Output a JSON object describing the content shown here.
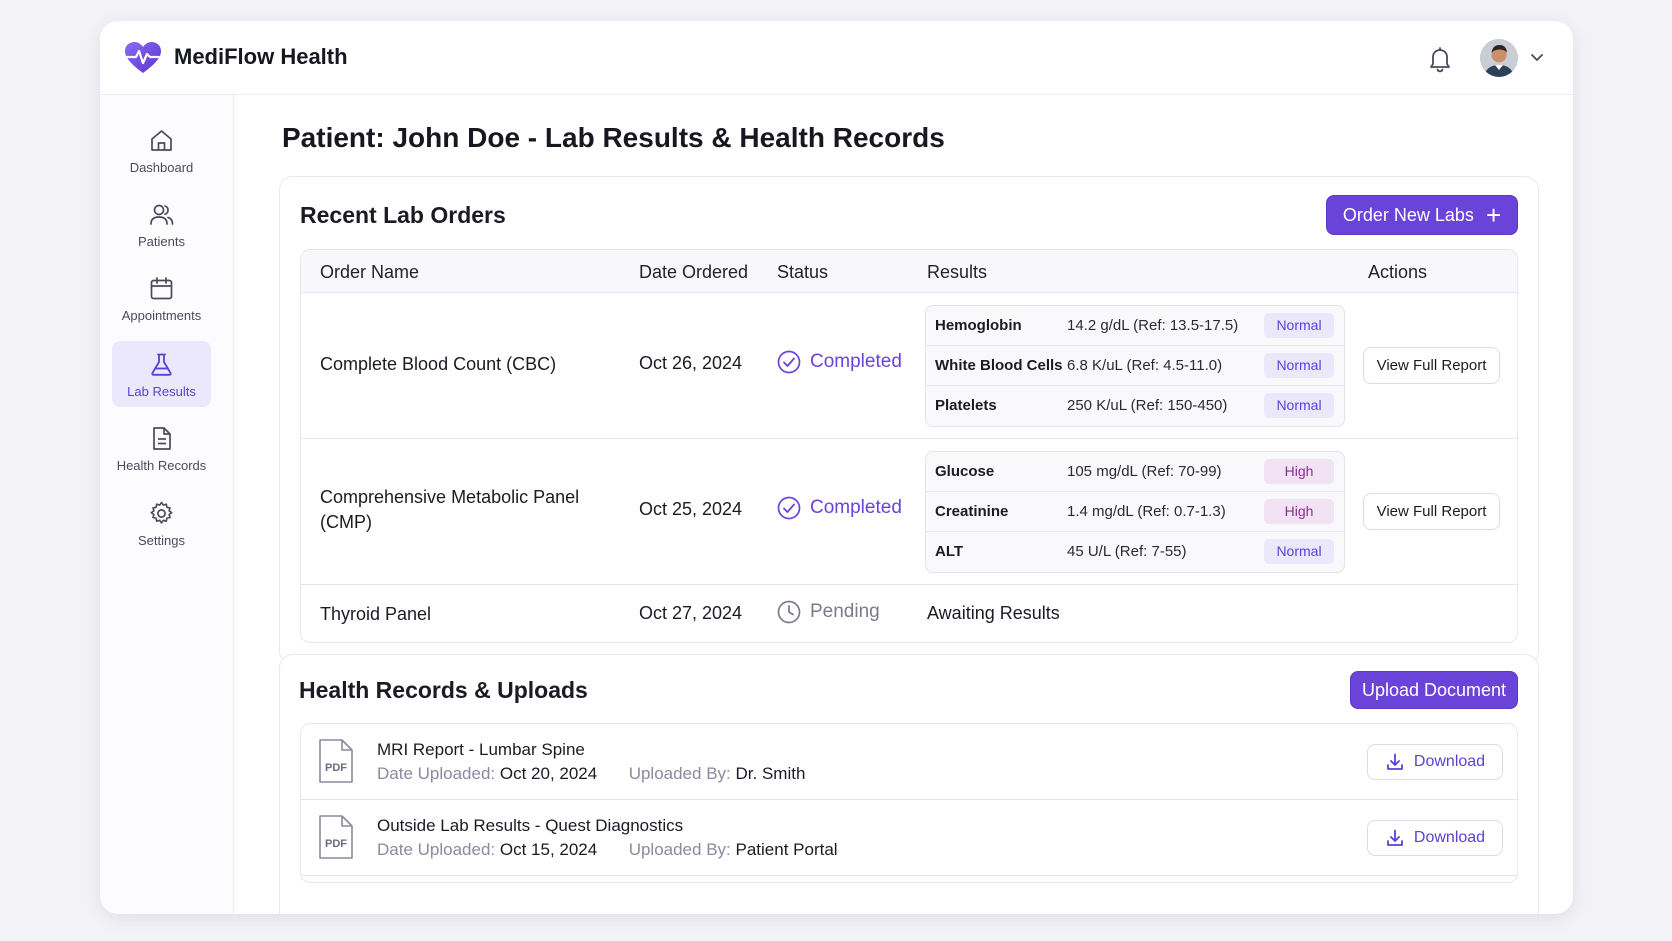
{
  "app": {
    "title": "MediFlow Health",
    "accent": "#6a43d9"
  },
  "sidebar": {
    "items": [
      {
        "label": "Dashboard",
        "icon": "home-icon"
      },
      {
        "label": "Patients",
        "icon": "users-icon"
      },
      {
        "label": "Appointments",
        "icon": "calendar-icon"
      },
      {
        "label": "Lab Results",
        "icon": "flask-icon",
        "active": true
      },
      {
        "label": "Health Records",
        "icon": "document-icon"
      },
      {
        "label": "Settings",
        "icon": "gear-icon"
      }
    ]
  },
  "page": {
    "title": "Patient: John Doe - Lab Results & Health Records"
  },
  "lab_orders": {
    "title": "Recent Lab Orders",
    "order_button": "Order New Labs",
    "headers": [
      "Order Name",
      "Date Ordered",
      "Status",
      "Results",
      "Actions"
    ],
    "rows": [
      {
        "name": "Complete Blood Count (CBC)",
        "date": "Oct 26, 2024",
        "status": "Completed",
        "results": [
          {
            "test": "Hemoglobin",
            "value": "14.2 g/dL (Ref: 13.5-17.5)",
            "flag": "Normal"
          },
          {
            "test": "White Blood Cells",
            "value": "6.8 K/uL (Ref: 4.5-11.0)",
            "flag": "Normal"
          },
          {
            "test": "Platelets",
            "value": "250 K/uL (Ref: 150-450)",
            "flag": "Normal"
          }
        ],
        "action": "View Full Report"
      },
      {
        "name": "Comprehensive Metabolic Panel (CMP)",
        "date": "Oct 25, 2024",
        "status": "Completed",
        "results": [
          {
            "test": "Glucose",
            "value": "105 mg/dL (Ref: 70-99)",
            "flag": "High"
          },
          {
            "test": "Creatinine",
            "value": "1.4 mg/dL (Ref: 0.7-1.3)",
            "flag": "High"
          },
          {
            "test": "ALT",
            "value": "45 U/L (Ref: 7-55)",
            "flag": "Normal"
          }
        ],
        "action": "View Full Report"
      },
      {
        "name": "Thyroid Panel",
        "date": "Oct 27, 2024",
        "status": "Pending",
        "results_text": "Awaiting Results"
      }
    ]
  },
  "records": {
    "title": "Health Records & Uploads",
    "upload_button": "Upload Document",
    "date_label": "Date Uploaded:",
    "by_label": "Uploaded By:",
    "download_label": "Download",
    "items": [
      {
        "title": "MRI Report - Lumbar Spine",
        "date": "Oct 20, 2024",
        "by": "Dr. Smith",
        "type": "PDF"
      },
      {
        "title": "Outside Lab Results - Quest Diagnostics",
        "date": "Oct 15, 2024",
        "by": "Patient Portal",
        "type": "PDF"
      }
    ]
  }
}
